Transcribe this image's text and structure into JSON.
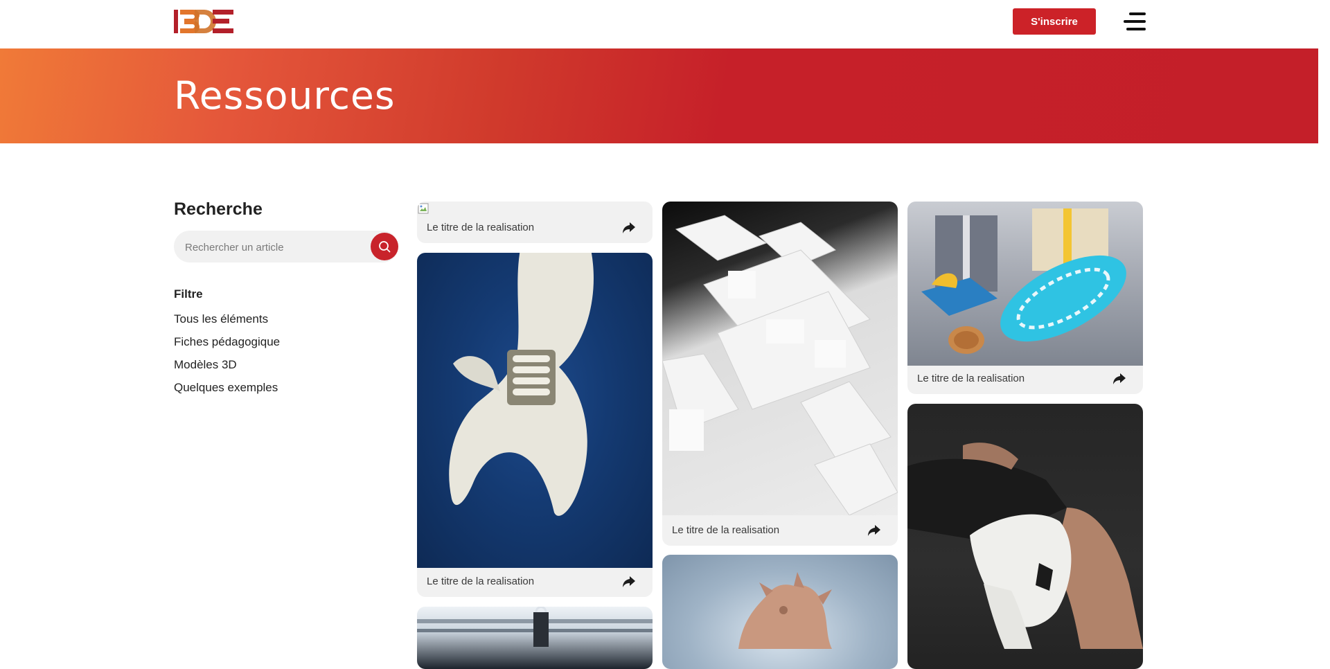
{
  "header": {
    "logo_text": "I3DE",
    "signup_label": "S'inscrire",
    "brand_color": "#cc2228"
  },
  "hero": {
    "title": "Ressources"
  },
  "sidebar": {
    "search_heading": "Recherche",
    "search_placeholder": "Rechercher un article",
    "filter_heading": "Filtre",
    "filters": [
      "Tous les éléments",
      "Fiches pédagogique",
      "Modèles 3D",
      "Quelques exemples"
    ]
  },
  "cards": [
    {
      "caption": "Le titre de la realisation",
      "image": "broken-image-icon"
    },
    {
      "caption": "Le titre de la realisation",
      "image": "3d-printed-wrench"
    },
    {
      "caption": "",
      "image": "3d-printer-frame"
    },
    {
      "caption": "Le titre de la realisation",
      "image": "architectural-city-model"
    },
    {
      "caption": "",
      "image": "dragon-figurine"
    },
    {
      "caption": "Le titre de la realisation",
      "image": "blue-lattice-bottle"
    },
    {
      "caption": "",
      "image": "knee-brace-prosthesis"
    }
  ],
  "icons": {
    "share": "share-arrow-icon",
    "search": "search-icon",
    "menu": "hamburger-menu-icon"
  }
}
